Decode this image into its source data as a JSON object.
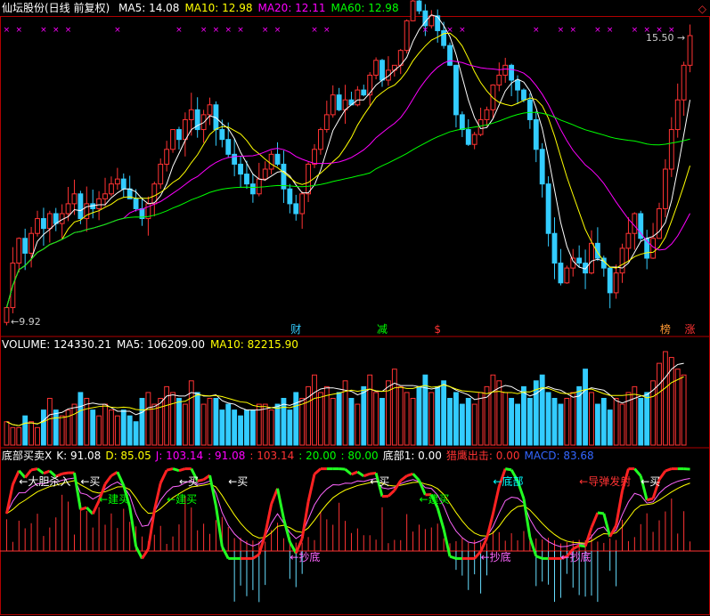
{
  "price_panel": {
    "title": "仙坛股份(日线 前复权)",
    "ma": [
      {
        "label": "MA5: ",
        "value": "14.08",
        "color": "#ffffff"
      },
      {
        "label": "MA10: ",
        "value": "12.98",
        "color": "#ffff00"
      },
      {
        "label": "MA20: ",
        "value": "12.11",
        "color": "#ff00ff"
      },
      {
        "label": "MA60: ",
        "value": "12.98",
        "color": "#00ff00"
      }
    ],
    "high_label": "15.50",
    "low_label": "9.92",
    "events": [
      {
        "text": "财",
        "day": 47,
        "color": "#33ccff"
      },
      {
        "text": "减",
        "day": 61,
        "color": "#00ff00"
      },
      {
        "text": "$",
        "day": 70,
        "color": "#ff3333"
      },
      {
        "text": "榜",
        "day": 107,
        "color": "#ff9933"
      },
      {
        "text": "涨",
        "day": 111,
        "color": "#ff3333"
      }
    ]
  },
  "volume_panel": {
    "items": [
      {
        "label": "VOLUME: ",
        "value": "124330.21",
        "color": "#ffffff"
      },
      {
        "label": "MA5: ",
        "value": "106209.00",
        "color": "#ffffff"
      },
      {
        "label": "MA10: ",
        "value": "82215.90",
        "color": "#ffff00"
      }
    ]
  },
  "indicator_panel": {
    "items": [
      {
        "text": "底部买卖X",
        "color": "#ffffff"
      },
      {
        "text": "K: 91.08",
        "color": "#ffffff"
      },
      {
        "text": "D: 85.05",
        "color": "#ffff00"
      },
      {
        "text": "J: 103.14",
        "color": "#ff00ff"
      },
      {
        "text": ": 91.08",
        "color": "#ff00ff"
      },
      {
        "text": ": 103.14",
        "color": "#ff3333"
      },
      {
        "text": ": 20.00",
        "color": "#00ff00"
      },
      {
        "text": ": 80.00",
        "color": "#00ff00"
      },
      {
        "text": "底部1: 0.00",
        "color": "#ffffff"
      },
      {
        "text": "猎鹰出击: 0.00",
        "color": "#ff3333"
      },
      {
        "text": "MACD: 83.68",
        "color": "#3366ff"
      }
    ],
    "annotations": [
      {
        "text": "←大胆杀入",
        "day": 2,
        "pos": "top",
        "color": "#ffffff"
      },
      {
        "text": "←买",
        "day": 12,
        "pos": "top",
        "color": "#ffffff"
      },
      {
        "text": "←建买",
        "day": 15,
        "pos": "mid",
        "color": "#00ff00"
      },
      {
        "text": "←买",
        "day": 28,
        "pos": "top",
        "color": "#ffffff"
      },
      {
        "text": "←建买",
        "day": 26,
        "pos": "mid",
        "color": "#00ff00"
      },
      {
        "text": "←买",
        "day": 36,
        "pos": "top",
        "color": "#ffffff"
      },
      {
        "text": "←抄底",
        "day": 46,
        "pos": "low",
        "color": "#ff66ff"
      },
      {
        "text": "←买",
        "day": 59,
        "pos": "top",
        "color": "#ffffff"
      },
      {
        "text": "←建买",
        "day": 67,
        "pos": "mid",
        "color": "#00ff00"
      },
      {
        "text": "←底部",
        "day": 79,
        "pos": "top",
        "color": "#00ffff"
      },
      {
        "text": "←抄底",
        "day": 77,
        "pos": "low",
        "color": "#ff66ff"
      },
      {
        "text": "←导弹发射",
        "day": 93,
        "pos": "top",
        "color": "#ff3333"
      },
      {
        "text": "←抄底",
        "day": 90,
        "pos": "low",
        "color": "#ff66ff"
      },
      {
        "text": "←买",
        "day": 103,
        "pos": "top",
        "color": "#ffffff"
      }
    ]
  },
  "chart_data": [
    {
      "type": "candlestick",
      "title": "仙坛股份(日线 前复权)",
      "note": "daily close approximated from chart; series MA5/MA10/MA20/MA60",
      "close": [
        10.0,
        10.9,
        11.4,
        11.1,
        11.5,
        11.8,
        11.6,
        11.9,
        11.7,
        11.9,
        12.1,
        12.3,
        11.8,
        12.1,
        12.0,
        12.2,
        12.3,
        12.5,
        12.6,
        12.4,
        12.2,
        12.0,
        11.8,
        12.1,
        12.5,
        12.9,
        13.2,
        13.6,
        13.4,
        13.8,
        14.0,
        13.6,
        13.9,
        14.1,
        13.6,
        13.4,
        13.1,
        12.9,
        12.7,
        12.5,
        12.3,
        12.6,
        12.8,
        13.1,
        12.9,
        12.4,
        12.1,
        11.9,
        12.3,
        12.9,
        13.2,
        13.6,
        13.9,
        14.3,
        14.0,
        14.2,
        14.1,
        14.4,
        14.3,
        14.7,
        15.0,
        14.6,
        14.8,
        14.9,
        15.2,
        15.8,
        16.2,
        16.0,
        15.7,
        15.9,
        15.6,
        15.3,
        14.9,
        13.9,
        13.6,
        13.3,
        13.5,
        13.8,
        14.0,
        14.5,
        14.7,
        14.9,
        14.6,
        14.4,
        14.2,
        13.8,
        13.2,
        12.5,
        11.5,
        10.9,
        10.5,
        10.8,
        11.0,
        10.9,
        10.7,
        11.3,
        11.0,
        10.8,
        10.3,
        10.7,
        11.2,
        11.5,
        11.9,
        11.4,
        11.0,
        11.4,
        12.0,
        12.8,
        13.6,
        14.2,
        14.9,
        15.5
      ],
      "ylim": [
        9.92,
        15.5
      ]
    },
    {
      "type": "bar",
      "title": "VOLUME",
      "series": [
        {
          "name": "VOLUME",
          "values": [
            4,
            3,
            3,
            5,
            4,
            3,
            6,
            8,
            6,
            5,
            6,
            7,
            9,
            8,
            6,
            5,
            7,
            6,
            5,
            6,
            5,
            4,
            8,
            9,
            7,
            8,
            10,
            9,
            8,
            7,
            11,
            9,
            7,
            8,
            8,
            6,
            7,
            6,
            5,
            6,
            6,
            7,
            7,
            6,
            7,
            8,
            6,
            9,
            8,
            10,
            12,
            9,
            10,
            8,
            9,
            11,
            8,
            7,
            10,
            12,
            9,
            8,
            11,
            13,
            10,
            9,
            8,
            10,
            12,
            9,
            10,
            11,
            8,
            9,
            7,
            8,
            7,
            9,
            10,
            12,
            11,
            9,
            8,
            7,
            10,
            8,
            11,
            12,
            9,
            8,
            7,
            8,
            9,
            10,
            13,
            9,
            7,
            8,
            6,
            8,
            7,
            9,
            10,
            8,
            9,
            11,
            14,
            16,
            15,
            13,
            12
          ]
        }
      ]
    },
    {
      "type": "line",
      "title": "底部买卖X",
      "series": [
        {
          "name": "K",
          "values": [
            91.08
          ]
        },
        {
          "name": "D",
          "values": [
            85.05
          ]
        },
        {
          "name": "J",
          "values": [
            103.14
          ]
        },
        {
          "name": "MACD",
          "values": [
            83.68
          ]
        }
      ]
    }
  ]
}
